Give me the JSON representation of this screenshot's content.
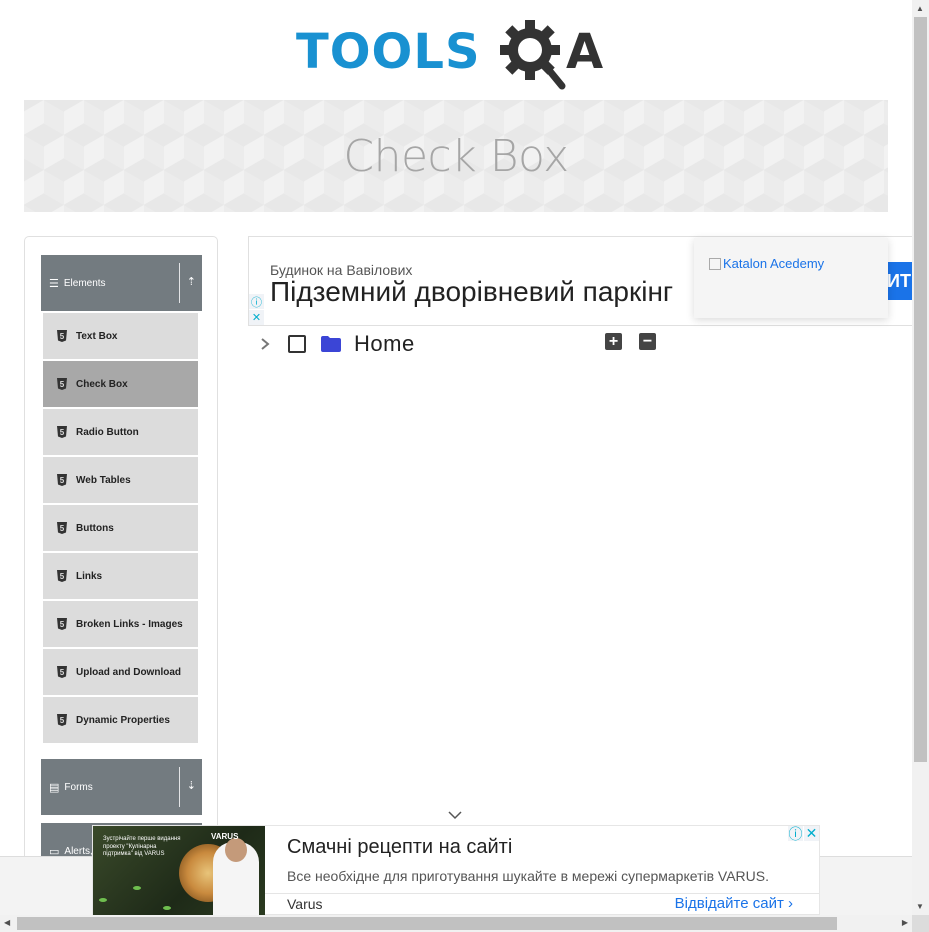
{
  "header": {
    "logo_part1": "TOOLS",
    "logo_part2": "A"
  },
  "banner": {
    "title": "Check Box"
  },
  "sidebar": {
    "groups": [
      {
        "label": "Elements",
        "icon": "hamburger-icon",
        "arrow": "upload-icon"
      },
      {
        "label": "Forms",
        "icon": "document-icon",
        "arrow": "download-icon"
      },
      {
        "label": "Alerts,",
        "icon": "window-icon"
      }
    ],
    "items": [
      {
        "label": "Text Box"
      },
      {
        "label": "Check Box",
        "active": true
      },
      {
        "label": "Radio Button"
      },
      {
        "label": "Web Tables"
      },
      {
        "label": "Buttons"
      },
      {
        "label": "Links"
      },
      {
        "label": "Broken Links - Images"
      },
      {
        "label": "Upload and Download"
      },
      {
        "label": "Dynamic Properties"
      }
    ],
    "item_icon": "html5-icon"
  },
  "top_ad": {
    "small_text": "Будинок на Вавілових",
    "big_text": "Підземний дворівневий паркінг",
    "button_text": "ИТИ"
  },
  "katalon": {
    "alt_text": "Katalon Acedemy"
  },
  "tree": {
    "label": "Home",
    "expand_all": "+",
    "collapse_all": "−"
  },
  "bottom_ad": {
    "thumb_text": "Зустрічайте перше видання проекту \"Кулінарна підтримка\" від VARUS",
    "thumb_brand": "VARUS",
    "headline": "Смачні рецепти на сайті",
    "sub": "Все необхідне для приготування шукайте в мережі супермаркетів VARUS.",
    "advertiser": "Varus",
    "visit": "Відвідайте сайт"
  },
  "colors": {
    "logo_blue": "#1991d1",
    "logo_dark": "#333333",
    "group_header": "#737b80",
    "menu_item": "#dcdcdc",
    "menu_active": "#a8a8a8",
    "folder": "#3b45d6",
    "ad_blue": "#1a73e8"
  }
}
